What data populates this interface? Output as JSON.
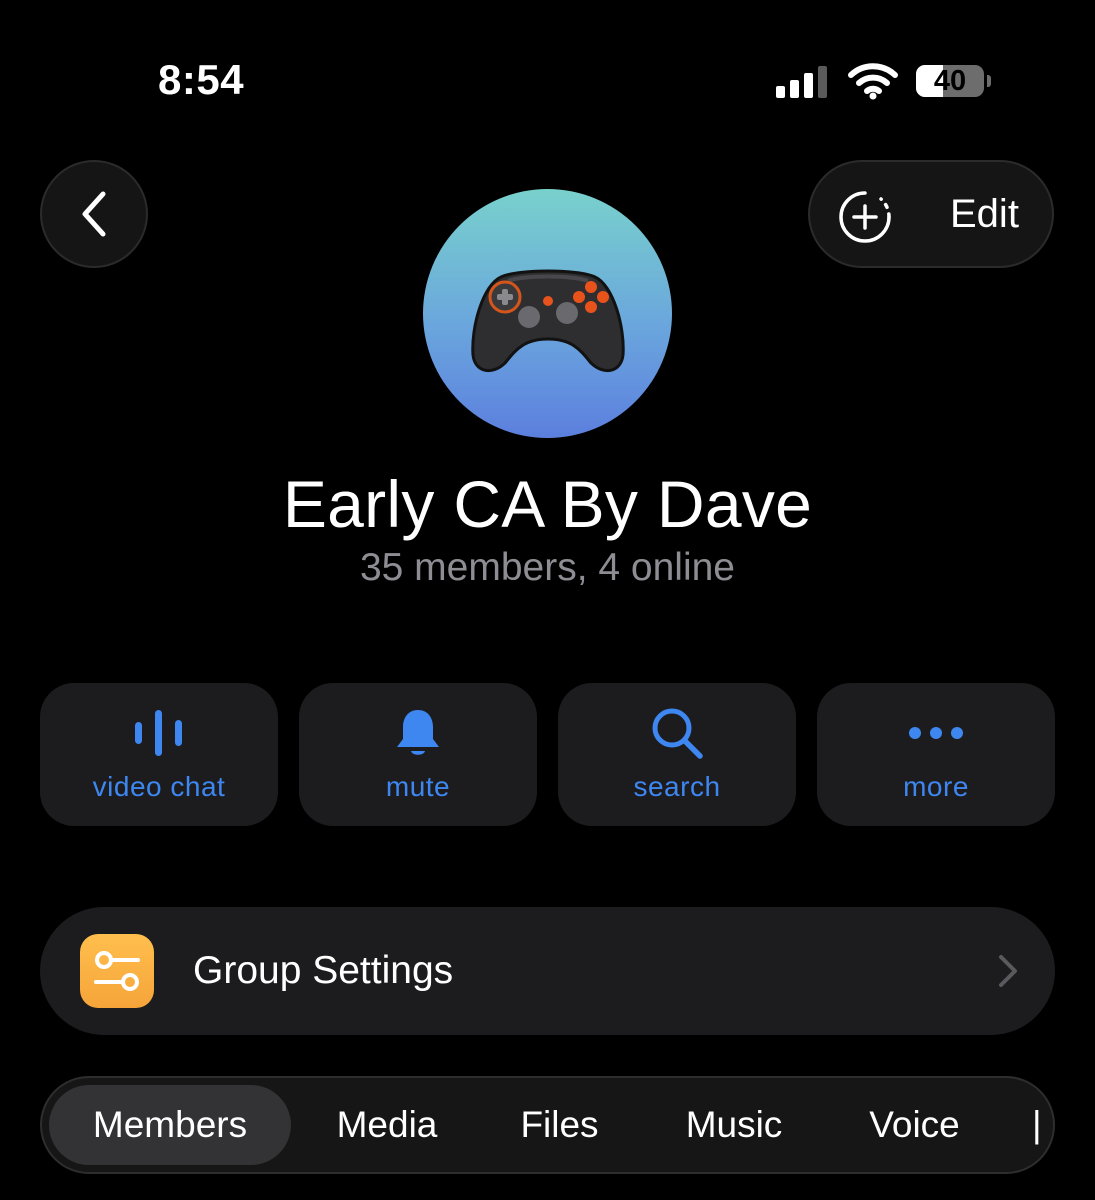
{
  "status_bar": {
    "time": "8:54",
    "battery_level": "40",
    "battery_fraction": 0.4
  },
  "header": {
    "back_icon": "chevron-left-icon",
    "edit_icon": "add-story-icon",
    "edit_label": "Edit"
  },
  "profile": {
    "avatar_icon": "game-controller-icon",
    "name": "Early CA By Dave",
    "subtitle": "35 members, 4 online"
  },
  "actions": [
    {
      "icon": "voice-bars-icon",
      "label": "video chat"
    },
    {
      "icon": "bell-icon",
      "label": "mute"
    },
    {
      "icon": "search-icon",
      "label": "search"
    },
    {
      "icon": "more-dots-icon",
      "label": "more"
    }
  ],
  "settings": {
    "icon": "sliders-icon",
    "label": "Group Settings",
    "chevron": "chevron-right-icon"
  },
  "tabs": [
    {
      "label": "Members",
      "active": true
    },
    {
      "label": "Media",
      "active": false
    },
    {
      "label": "Files",
      "active": false
    },
    {
      "label": "Music",
      "active": false
    },
    {
      "label": "Voice",
      "active": false
    }
  ],
  "colors": {
    "background": "#000000",
    "card": "#1c1c1e",
    "accent": "#3e86f0",
    "secondary_text": "#8d8d93",
    "settings_icon": "#f6a43a"
  }
}
